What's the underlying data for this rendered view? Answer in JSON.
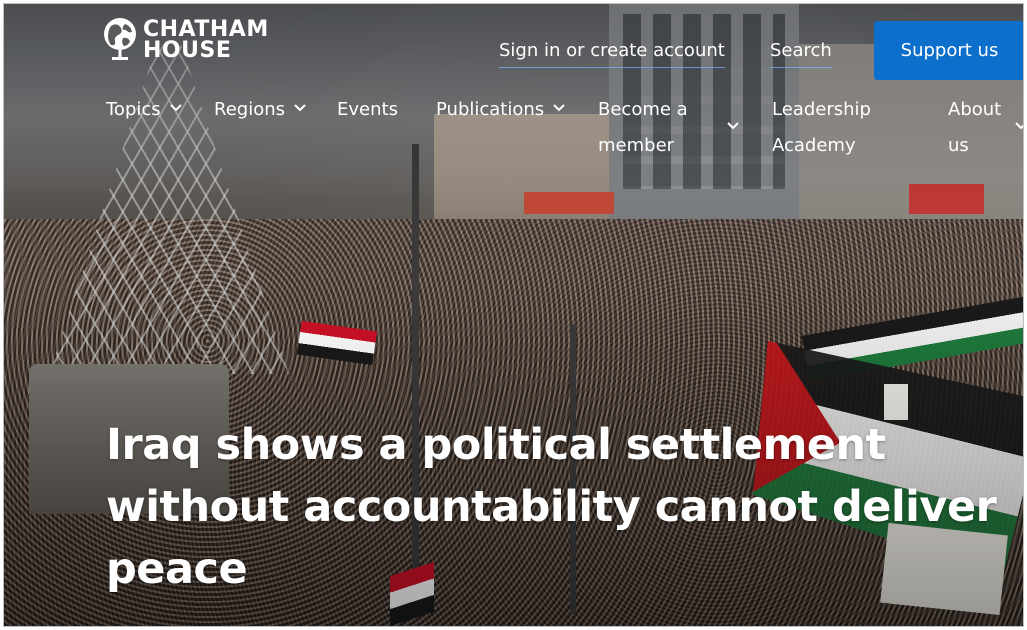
{
  "header": {
    "logo": {
      "line1": "CHATHAM",
      "line2": "HOUSE"
    },
    "signin_label": "Sign in or create account",
    "search_label": "Search",
    "support_label": "Support us"
  },
  "nav": {
    "items": [
      {
        "label": "Topics",
        "icon": "chevron-down-icon"
      },
      {
        "label": "Regions",
        "icon": "chevron-down-icon"
      },
      {
        "label": "Events"
      },
      {
        "label": "Publications",
        "icon": "chevron-down-icon"
      },
      {
        "label": "Become a member",
        "icon": "chevron-down-icon"
      },
      {
        "label": "Leadership Academy"
      },
      {
        "label": "About us",
        "icon": "chevron-down-icon"
      }
    ]
  },
  "hero": {
    "headline": "Iraq shows a political settlement without accountability cannot deliver peace"
  },
  "colors": {
    "support_button": "#0b6fcb",
    "text": "#ffffff"
  }
}
